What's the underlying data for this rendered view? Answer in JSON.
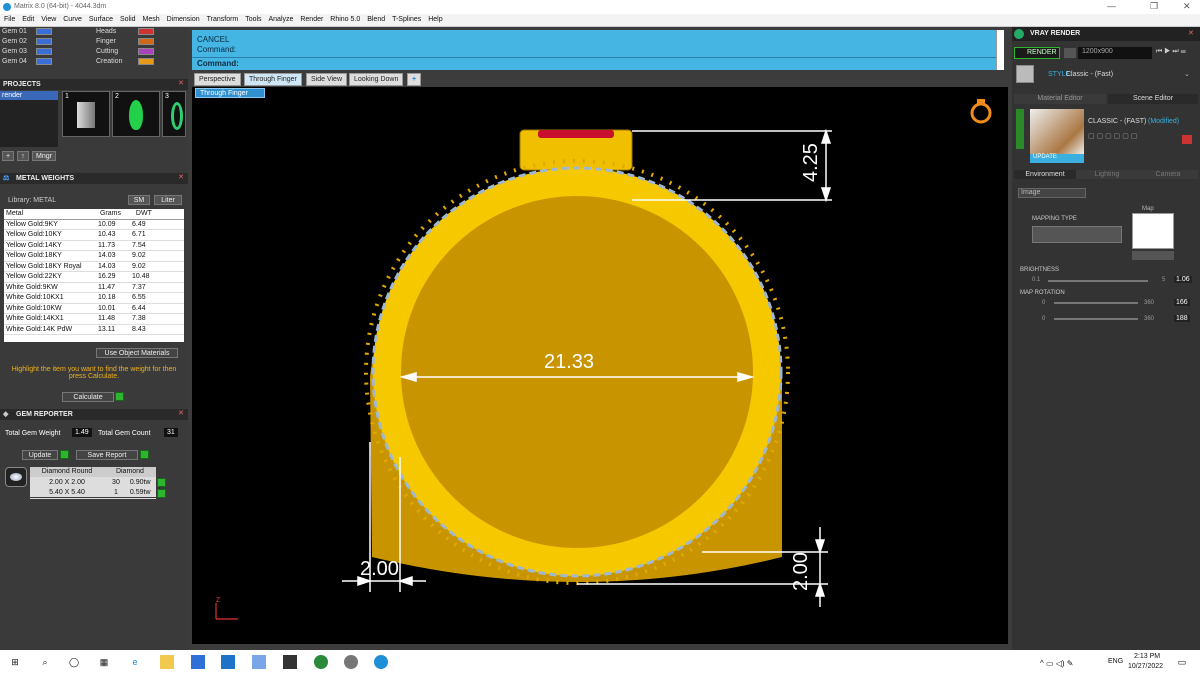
{
  "titlebar": {
    "title": "Matrix 8.0 (64-bit) - 4044.3dm",
    "min": "—",
    "max": "❐",
    "close": "✕"
  },
  "menu": [
    "File",
    "Edit",
    "View",
    "Curve",
    "Surface",
    "Solid",
    "Mesh",
    "Dimension",
    "Transform",
    "Tools",
    "Analyze",
    "Render",
    "Rhino 5.0",
    "Blend",
    "T-Splines",
    "Help"
  ],
  "left": {
    "gems": [
      {
        "label": "Gem 01",
        "color": "#3a6fd8"
      },
      {
        "label": "Gem 02",
        "color": "#3a6fd8"
      },
      {
        "label": "Gem 03",
        "color": "#3a6fd8"
      },
      {
        "label": "Gem 04",
        "color": "#3a6fd8"
      }
    ],
    "presets": [
      {
        "label": "Heads",
        "color": "#cc3333"
      },
      {
        "label": "Finger",
        "color": "#cc6a1a"
      },
      {
        "label": "Cutting",
        "color": "#aa44bb"
      },
      {
        "label": "Creation",
        "color": "#e69a1a"
      }
    ],
    "projects_title": "PROJECTS",
    "project_item": "render",
    "thumb_nums": [
      "1",
      "2",
      "3"
    ],
    "project_btns": [
      "+",
      "↑",
      "Mngr"
    ],
    "metal_title": "METAL WEIGHTS",
    "library_label": "Library: METAL",
    "unit_btns": [
      "SM",
      "Liter"
    ],
    "metal_headers": [
      "Metal",
      "Grams",
      "DWT"
    ],
    "metals": [
      [
        "Yellow Gold:9KY",
        "10.09",
        "6.49"
      ],
      [
        "Yellow Gold:10KY",
        "10.43",
        "6.71"
      ],
      [
        "Yellow Gold:14KY",
        "11.73",
        "7.54"
      ],
      [
        "Yellow Gold:18KY",
        "14.03",
        "9.02"
      ],
      [
        "Yellow Gold:18KY Royal",
        "14.03",
        "9.02"
      ],
      [
        "Yellow Gold:22KY",
        "16.29",
        "10.48"
      ],
      [
        "White Gold:9KW",
        "11.47",
        "7.37"
      ],
      [
        "White Gold:10KX1",
        "10.18",
        "6.55"
      ],
      [
        "White Gold:10KW",
        "10.01",
        "6.44"
      ],
      [
        "White Gold:14KX1",
        "11.48",
        "7.38"
      ],
      [
        "White Gold:14K PdW",
        "13.11",
        "8.43"
      ]
    ],
    "use_obj_materials": "Use Object Materials",
    "instructions": "Highlight the item you want to find the weight for then press Calculate.",
    "calculate": "Calculate",
    "gem_reporter_title": "GEM REPORTER",
    "total_gem_weight_label": "Total Gem Weight",
    "total_gem_weight": "1.49",
    "total_gem_count_label": "Total Gem Count",
    "total_gem_count": "31",
    "update": "Update",
    "save_report": "Save Report",
    "gem_headers": [
      "Diamond Round",
      "Diamond"
    ],
    "gem_rows": [
      [
        "2.00 X 2.00",
        "30",
        "0.90tw"
      ],
      [
        "5.40 X 5.40",
        "1",
        "0.59tw"
      ]
    ]
  },
  "command": {
    "line1": "CANCEL",
    "line2": "Command:",
    "prompt": "Command:"
  },
  "tabs": [
    "Perspective",
    "Through Finger",
    "Side View",
    "Looking Down",
    "+"
  ],
  "viewport_label": "Through Finger",
  "dims": {
    "top": "4.25",
    "inner": "21.33",
    "left": "2.00",
    "right": "2.00"
  },
  "axis_label": "Z",
  "right": {
    "title": "VRAY RENDER",
    "render_btn": "RENDER",
    "resolution": "1200x900",
    "style_label": "STYLE:",
    "style_value": "Classic - (Fast)",
    "tabs": [
      "Material Editor",
      "Scene Editor"
    ],
    "material_name": "CLASSIC - (FAST)",
    "modified": "(Modified)",
    "update": "UPDATE",
    "env_tabs": [
      "Environment",
      "Lighting",
      "Camera"
    ],
    "env_select": "Image",
    "map_label": "Map",
    "mapping_type": "MAPPING TYPE",
    "brightness": "BRIGHTNESS",
    "bright_min": "0.1",
    "bright_max": "5",
    "bright_val": "1.06",
    "map_rotation": "MAP ROTATION",
    "rot_min1": "0",
    "rot_max1": "360",
    "rot_val1": "166",
    "rot_min2": "0",
    "rot_max2": "360",
    "rot_val2": "188"
  },
  "taskbar": {
    "lang": "ENG",
    "time": "2:13 PM",
    "date": "10/27/2022"
  },
  "colors": {
    "accent": "#45b5e3",
    "gold": "#f5c800",
    "ruby": "#c8102e"
  }
}
